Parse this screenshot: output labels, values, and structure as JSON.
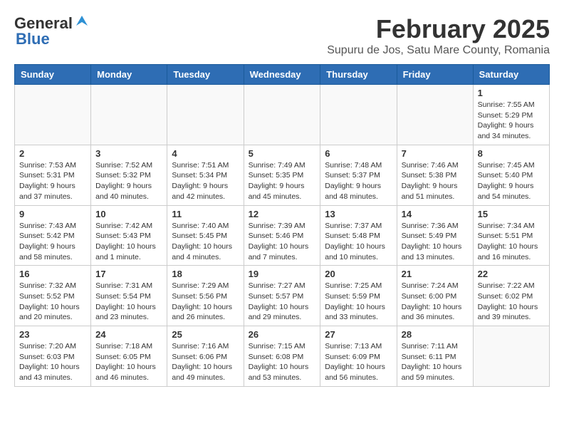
{
  "logo": {
    "general": "General",
    "blue": "Blue"
  },
  "title": "February 2025",
  "subtitle": "Supuru de Jos, Satu Mare County, Romania",
  "days_of_week": [
    "Sunday",
    "Monday",
    "Tuesday",
    "Wednesday",
    "Thursday",
    "Friday",
    "Saturday"
  ],
  "weeks": [
    [
      {
        "day": "",
        "info": ""
      },
      {
        "day": "",
        "info": ""
      },
      {
        "day": "",
        "info": ""
      },
      {
        "day": "",
        "info": ""
      },
      {
        "day": "",
        "info": ""
      },
      {
        "day": "",
        "info": ""
      },
      {
        "day": "1",
        "info": "Sunrise: 7:55 AM\nSunset: 5:29 PM\nDaylight: 9 hours and 34 minutes."
      }
    ],
    [
      {
        "day": "2",
        "info": "Sunrise: 7:53 AM\nSunset: 5:31 PM\nDaylight: 9 hours and 37 minutes."
      },
      {
        "day": "3",
        "info": "Sunrise: 7:52 AM\nSunset: 5:32 PM\nDaylight: 9 hours and 40 minutes."
      },
      {
        "day": "4",
        "info": "Sunrise: 7:51 AM\nSunset: 5:34 PM\nDaylight: 9 hours and 42 minutes."
      },
      {
        "day": "5",
        "info": "Sunrise: 7:49 AM\nSunset: 5:35 PM\nDaylight: 9 hours and 45 minutes."
      },
      {
        "day": "6",
        "info": "Sunrise: 7:48 AM\nSunset: 5:37 PM\nDaylight: 9 hours and 48 minutes."
      },
      {
        "day": "7",
        "info": "Sunrise: 7:46 AM\nSunset: 5:38 PM\nDaylight: 9 hours and 51 minutes."
      },
      {
        "day": "8",
        "info": "Sunrise: 7:45 AM\nSunset: 5:40 PM\nDaylight: 9 hours and 54 minutes."
      }
    ],
    [
      {
        "day": "9",
        "info": "Sunrise: 7:43 AM\nSunset: 5:42 PM\nDaylight: 9 hours and 58 minutes."
      },
      {
        "day": "10",
        "info": "Sunrise: 7:42 AM\nSunset: 5:43 PM\nDaylight: 10 hours and 1 minute."
      },
      {
        "day": "11",
        "info": "Sunrise: 7:40 AM\nSunset: 5:45 PM\nDaylight: 10 hours and 4 minutes."
      },
      {
        "day": "12",
        "info": "Sunrise: 7:39 AM\nSunset: 5:46 PM\nDaylight: 10 hours and 7 minutes."
      },
      {
        "day": "13",
        "info": "Sunrise: 7:37 AM\nSunset: 5:48 PM\nDaylight: 10 hours and 10 minutes."
      },
      {
        "day": "14",
        "info": "Sunrise: 7:36 AM\nSunset: 5:49 PM\nDaylight: 10 hours and 13 minutes."
      },
      {
        "day": "15",
        "info": "Sunrise: 7:34 AM\nSunset: 5:51 PM\nDaylight: 10 hours and 16 minutes."
      }
    ],
    [
      {
        "day": "16",
        "info": "Sunrise: 7:32 AM\nSunset: 5:52 PM\nDaylight: 10 hours and 20 minutes."
      },
      {
        "day": "17",
        "info": "Sunrise: 7:31 AM\nSunset: 5:54 PM\nDaylight: 10 hours and 23 minutes."
      },
      {
        "day": "18",
        "info": "Sunrise: 7:29 AM\nSunset: 5:56 PM\nDaylight: 10 hours and 26 minutes."
      },
      {
        "day": "19",
        "info": "Sunrise: 7:27 AM\nSunset: 5:57 PM\nDaylight: 10 hours and 29 minutes."
      },
      {
        "day": "20",
        "info": "Sunrise: 7:25 AM\nSunset: 5:59 PM\nDaylight: 10 hours and 33 minutes."
      },
      {
        "day": "21",
        "info": "Sunrise: 7:24 AM\nSunset: 6:00 PM\nDaylight: 10 hours and 36 minutes."
      },
      {
        "day": "22",
        "info": "Sunrise: 7:22 AM\nSunset: 6:02 PM\nDaylight: 10 hours and 39 minutes."
      }
    ],
    [
      {
        "day": "23",
        "info": "Sunrise: 7:20 AM\nSunset: 6:03 PM\nDaylight: 10 hours and 43 minutes."
      },
      {
        "day": "24",
        "info": "Sunrise: 7:18 AM\nSunset: 6:05 PM\nDaylight: 10 hours and 46 minutes."
      },
      {
        "day": "25",
        "info": "Sunrise: 7:16 AM\nSunset: 6:06 PM\nDaylight: 10 hours and 49 minutes."
      },
      {
        "day": "26",
        "info": "Sunrise: 7:15 AM\nSunset: 6:08 PM\nDaylight: 10 hours and 53 minutes."
      },
      {
        "day": "27",
        "info": "Sunrise: 7:13 AM\nSunset: 6:09 PM\nDaylight: 10 hours and 56 minutes."
      },
      {
        "day": "28",
        "info": "Sunrise: 7:11 AM\nSunset: 6:11 PM\nDaylight: 10 hours and 59 minutes."
      },
      {
        "day": "",
        "info": ""
      }
    ]
  ]
}
